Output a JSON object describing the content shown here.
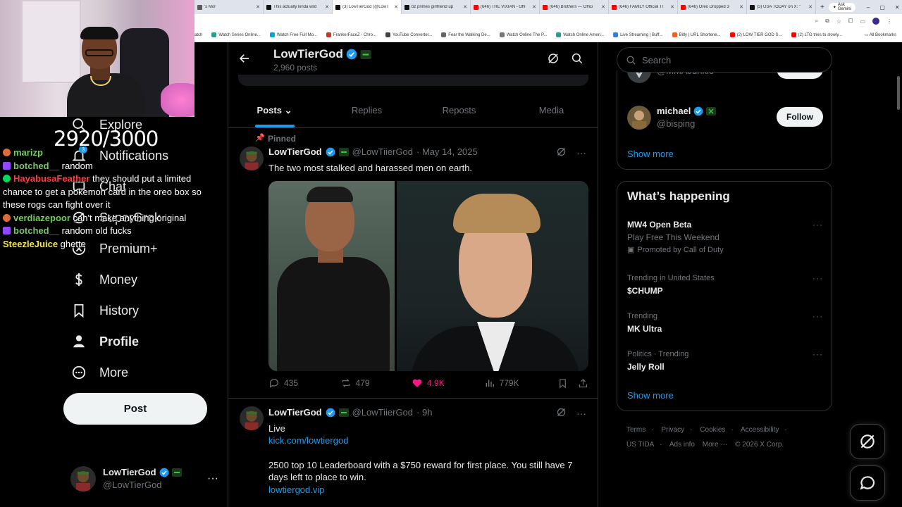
{
  "browser": {
    "tabs": [
      {
        "title": "'s Mor",
        "color": "#5a5a5a",
        "active": false
      },
      {
        "title": "This actually kinda wild",
        "color": "#111111",
        "active": false
      },
      {
        "title": "(3) LowTierGod (@LowT",
        "color": "#111111",
        "active": true
      },
      {
        "title": "bz primes girlfriend up",
        "color": "#111111",
        "active": false
      },
      {
        "title": "(646) THE VIXIAN - Offi",
        "color": "#ff0000",
        "active": false
      },
      {
        "title": "(646) Brothers — Offici",
        "color": "#ff0000",
        "active": false
      },
      {
        "title": "(646) FAMILY Official Tr",
        "color": "#ff0000",
        "active": false
      },
      {
        "title": "(646) Oreo Dropped 3",
        "color": "#ff0000",
        "active": false
      },
      {
        "title": "(3) USA TODAY on X: \"",
        "color": "#111111",
        "active": false
      }
    ],
    "new_tab": "+",
    "ask_gemini": "Ask Gemini",
    "window_controls": [
      "–",
      "▢",
      "✕"
    ],
    "bookmarks": [
      {
        "label": "atch",
        "color": "#888888"
      },
      {
        "label": "Watch Series Online...",
        "color": "#2a9d8f"
      },
      {
        "label": "Watch Free Full Mo...",
        "color": "#00a6d6"
      },
      {
        "label": "FrankerFaceZ - Chro...",
        "color": "#c0392b"
      },
      {
        "label": "YouTube Converter...",
        "color": "#444444"
      },
      {
        "label": "Fear the Walking De...",
        "color": "#666666"
      },
      {
        "label": "Watch Online The P...",
        "color": "#777777"
      },
      {
        "label": "Watch Online Ameri...",
        "color": "#2a9d8f"
      },
      {
        "label": "Live Streaming | Buff...",
        "color": "#3a7bd5"
      },
      {
        "label": "Bitly | URL Shortene...",
        "color": "#ee6123"
      },
      {
        "label": "(2) LOW TIER GOD S...",
        "color": "#ff0000"
      },
      {
        "label": "(2) LTG tries to slowly...",
        "color": "#ff0000"
      }
    ],
    "all_bookmarks": "All Bookmarks"
  },
  "overlay": {
    "counter": "2920/3000"
  },
  "nav": {
    "explore": "Explore",
    "notifications": "Notifications",
    "notifications_badge": "3",
    "chat": "Chat",
    "supergrok": "SuperGrok",
    "premium": "Premium+",
    "money": "Money",
    "history": "History",
    "profile": "Profile",
    "more": "More",
    "post": "Post"
  },
  "account": {
    "name": "LowTierGod",
    "handle": "@LowTierGod",
    "more": "···"
  },
  "chat": [
    {
      "user": "marizp",
      "msg": "",
      "color": "#6fcf57",
      "icon": "#e06b3a"
    },
    {
      "user": "botched__",
      "msg": "random",
      "color": "#7cc36e",
      "icon": "#9146ff"
    },
    {
      "user": "HayabusaFeather",
      "msg": "they should put a limited chance to get a pokemon card in the oreo box so these rogs can fight over it",
      "color": "#ff3b3b",
      "icon": "#00d95a"
    },
    {
      "user": "verdiazepoor",
      "msg": "can't make anything original",
      "color": "#6fcf57",
      "icon": "#e06b3a"
    },
    {
      "user": "botched__",
      "msg": "random old fucks",
      "color": "#7cc36e",
      "icon": "#9146ff"
    },
    {
      "user": "SteezleJuice",
      "msg": "ghette",
      "color": "#f5e64a",
      "icon": ""
    }
  ],
  "profile_header": {
    "name": "LowTierGod",
    "posts_count": "2,960 posts"
  },
  "profile_tabs": [
    "Posts",
    "Replies",
    "Reposts",
    "Media"
  ],
  "tweets": [
    {
      "pinned": "Pinned",
      "name": "LowTierGod",
      "handle": "@LowTiierGod",
      "date": "· May 14, 2025",
      "text": "The two most stalked and harassed men on earth.",
      "replies": "435",
      "reposts": "479",
      "likes": "4.9K",
      "views": "779K"
    },
    {
      "name": "LowTierGod",
      "handle": "@LowTiierGod",
      "date": "· 9h",
      "line1": "Live",
      "link1": "kick.com/lowtiergod",
      "line2": "2500 top 10 Leaderboard with a $750 reward for first place. You still have 7 days left to place to win.",
      "link2": "lowtiergod.vip"
    }
  ],
  "right": {
    "search_placeholder": "Search",
    "who_to_follow": [
      {
        "name": "",
        "handle": "@MMAJunkie",
        "follow": "Follow"
      },
      {
        "name": "michael",
        "handle": "@bisping",
        "follow": "Follow"
      }
    ],
    "show_more": "Show more",
    "whats_happening": "What’s happening",
    "trends": [
      {
        "context": "",
        "name": "MW4 Open Beta",
        "sub": "Play Free This Weekend",
        "promo": "Promoted by Call of Duty"
      },
      {
        "context": "Trending in United States",
        "name": "$CHUMP"
      },
      {
        "context": "Trending",
        "name": "MK Ultra"
      },
      {
        "context": "Politics · Trending",
        "name": "Jelly Roll"
      }
    ],
    "show_more_2": "Show more",
    "footer": [
      "Terms",
      "Privacy",
      "Cookies",
      "Accessibility",
      "·",
      "US TIDA",
      "Ads info",
      "More ···",
      "© 2026 X Corp."
    ]
  }
}
